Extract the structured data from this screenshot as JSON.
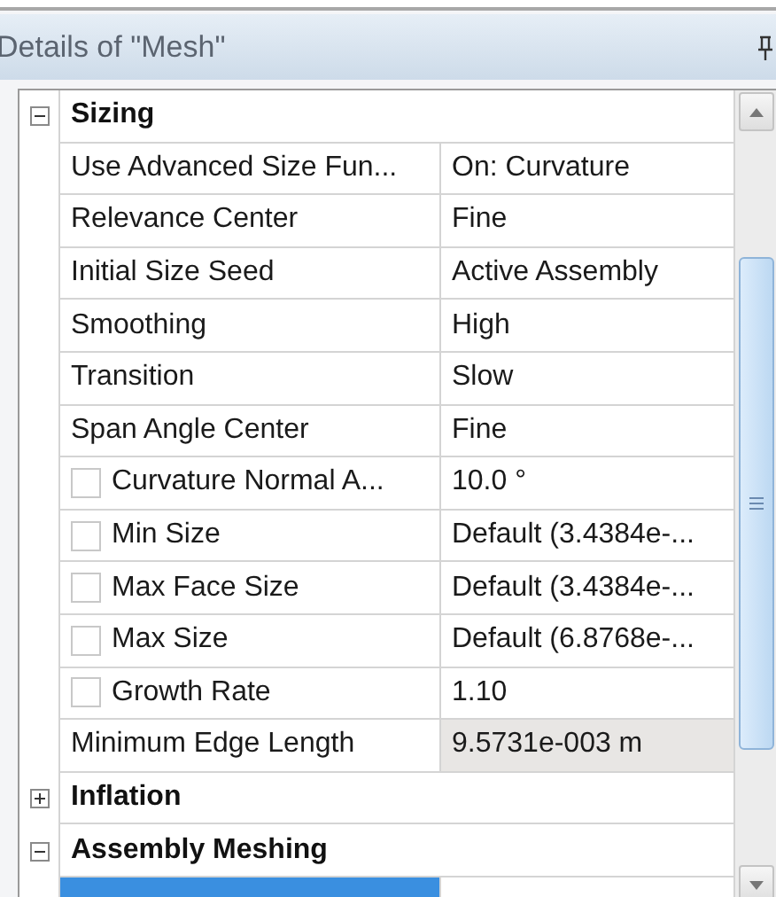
{
  "panel": {
    "title": "Details of \"Mesh\""
  },
  "sections": [
    {
      "label": "Sizing",
      "expanded": true,
      "rows": [
        {
          "kind": "plain",
          "label": "Use Advanced Size Fun...",
          "value": "On: Curvature",
          "readonly": false,
          "selected": false
        },
        {
          "kind": "plain",
          "label": "Relevance Center",
          "value": "Fine",
          "readonly": false,
          "selected": false
        },
        {
          "kind": "plain",
          "label": "Initial Size Seed",
          "value": "Active Assembly",
          "readonly": false,
          "selected": false
        },
        {
          "kind": "plain",
          "label": "Smoothing",
          "value": "High",
          "readonly": false,
          "selected": false
        },
        {
          "kind": "plain",
          "label": "Transition",
          "value": "Slow",
          "readonly": false,
          "selected": false
        },
        {
          "kind": "plain",
          "label": "Span Angle Center",
          "value": "Fine",
          "readonly": false,
          "selected": false
        },
        {
          "kind": "checkbox",
          "checked": false,
          "label": "Curvature Normal A...",
          "value": "10.0 °",
          "readonly": false,
          "selected": false
        },
        {
          "kind": "checkbox",
          "checked": false,
          "label": "Min Size",
          "value": "Default (3.4384e-...",
          "readonly": false,
          "selected": false
        },
        {
          "kind": "checkbox",
          "checked": false,
          "label": "Max Face Size",
          "value": "Default (3.4384e-...",
          "readonly": false,
          "selected": false
        },
        {
          "kind": "checkbox",
          "checked": false,
          "label": "Max Size",
          "value": "Default (6.8768e-...",
          "readonly": false,
          "selected": false
        },
        {
          "kind": "checkbox",
          "checked": false,
          "label": "Growth Rate",
          "value": "1.10",
          "readonly": false,
          "selected": false
        },
        {
          "kind": "plain",
          "label": "Minimum Edge Length",
          "value": "9.5731e-003 m",
          "readonly": true,
          "selected": false
        }
      ]
    },
    {
      "label": "Inflation",
      "expanded": false
    },
    {
      "label": "Assembly Meshing",
      "expanded": true,
      "rows": [
        {
          "kind": "plain",
          "readonly": false,
          "selected": true
        }
      ]
    }
  ]
}
